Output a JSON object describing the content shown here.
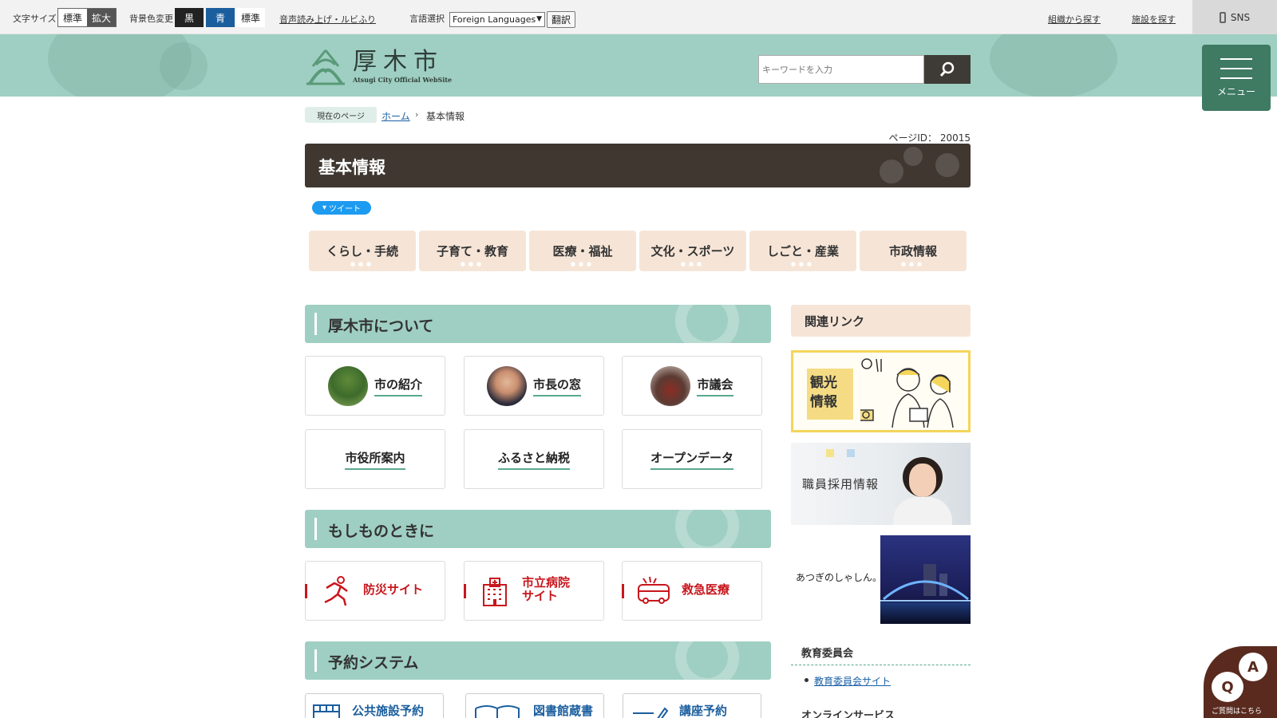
{
  "topbar": {
    "font_size_label": "文字サイズ",
    "font_size_standard": "標準",
    "font_size_large": "拡大",
    "bg_color_label": "背景色変更",
    "bg_black": "黒",
    "bg_blue": "青",
    "bg_standard": "標準",
    "speech_ruby_link": "音声読み上げ・ルビふり",
    "language_label": "言語選択",
    "language_selected": "Foreign Languages",
    "translate_button": "翻訳",
    "org_search_link": "組織から探す",
    "facility_search_link": "施設を探す",
    "sns_label": "SNS"
  },
  "header": {
    "site_title": "厚木市",
    "site_subtitle": "Atsugi City Official WebSite",
    "search_placeholder": "キーワードを入力",
    "menu_label": "メニュー"
  },
  "breadcrumb": {
    "current_label": "現在のページ",
    "home": "ホーム",
    "current": "基本情報"
  },
  "page": {
    "page_id": "ページID： 20015",
    "title": "基本情報",
    "tweet_label": "ツイート"
  },
  "categories": [
    {
      "label": "くらし・手続"
    },
    {
      "label": "子育て・教育"
    },
    {
      "label": "医療・福祉"
    },
    {
      "label": "文化・スポーツ"
    },
    {
      "label": "しごと・産業"
    },
    {
      "label": "市政情報"
    }
  ],
  "sections": {
    "about": {
      "title": "厚木市について",
      "cards": [
        {
          "label": "市の紹介"
        },
        {
          "label": "市長の窓"
        },
        {
          "label": "市議会"
        },
        {
          "label": "市役所案内"
        },
        {
          "label": "ふるさと納税"
        },
        {
          "label": "オープンデータ"
        }
      ]
    },
    "emergency": {
      "title": "もしものときに",
      "cards": [
        {
          "label": "防災サイト"
        },
        {
          "label": "市立病院サイト",
          "line1": "市立病院",
          "line2": "サイト"
        },
        {
          "label": "救急医療"
        }
      ]
    },
    "reservation": {
      "title": "予約システム",
      "cards": [
        {
          "label": "公共施設予約"
        },
        {
          "label": "図書館蔵書"
        },
        {
          "label": "講座予約"
        }
      ]
    }
  },
  "sidebar": {
    "related_links_title": "関連リンク",
    "tourism_banner": "観光情報",
    "tourism_line1": "観光",
    "tourism_line2": "情報",
    "recruit_banner": "職員採用情報",
    "atsugi_logo": "あつぎのしゃしん。",
    "education_title": "教育委員会",
    "education_link": "教育委員会サイト",
    "online_title": "オンラインサービス"
  },
  "chat": {
    "q": "Q",
    "a": "A",
    "label": "ご質問はこちら"
  },
  "colors": {
    "header_teal": "#9fcfc2",
    "menu_green": "#3f7a63",
    "title_brown": "#3f3730",
    "category_beige": "#f6e5d7",
    "emergency_red": "#c8161d",
    "reservation_blue": "#1b5e9e"
  }
}
